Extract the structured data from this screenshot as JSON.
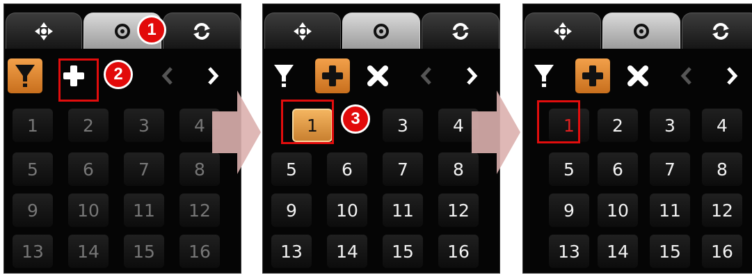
{
  "tabs": {
    "move_icon": "move-arrows-icon",
    "view_icon": "circle-dot-icon",
    "refresh_icon": "refresh-icon"
  },
  "toolbar": {
    "filter_icon": "funnel-icon",
    "add_icon": "plus-icon",
    "delete_icon": "x-icon",
    "prev_label": "<",
    "next_label": ">"
  },
  "presets": [
    "1",
    "2",
    "3",
    "4",
    "5",
    "6",
    "7",
    "8",
    "9",
    "10",
    "11",
    "12",
    "13",
    "14",
    "15",
    "16"
  ],
  "steps": {
    "step1": "1",
    "step2": "2",
    "step3": "3"
  },
  "colors": {
    "orange": "#e7871f",
    "red": "#e20d0d",
    "flow_arrow": "#dba9a9"
  }
}
